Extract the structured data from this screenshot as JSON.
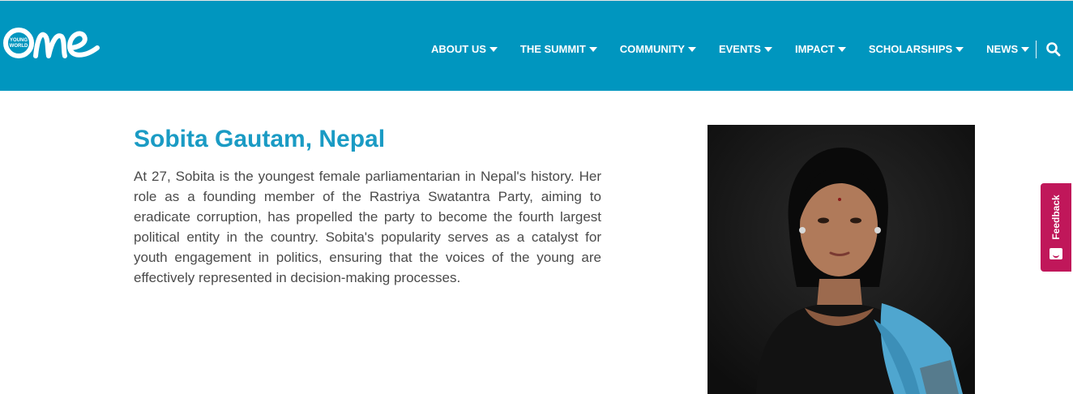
{
  "colors": {
    "header_bg": "#0096bf",
    "title": "#1a9bc4",
    "body_text": "#4a4a4a",
    "feedback_bg": "#c0175a"
  },
  "logo": {
    "small_text_line1": "YOUNG",
    "small_text_line2": "WORLD",
    "wordmark": "one",
    "icon": "one-young-world-logo"
  },
  "nav": {
    "items": [
      {
        "label": "ABOUT US",
        "icon": "caret-down-icon"
      },
      {
        "label": "THE SUMMIT",
        "icon": "caret-down-icon"
      },
      {
        "label": "COMMUNITY",
        "icon": "caret-down-icon"
      },
      {
        "label": "EVENTS",
        "icon": "caret-down-icon"
      },
      {
        "label": "IMPACT",
        "icon": "caret-down-icon"
      },
      {
        "label": "SCHOLARSHIPS",
        "icon": "caret-down-icon"
      },
      {
        "label": "NEWS",
        "icon": "caret-down-icon"
      }
    ],
    "search_icon": "search-icon"
  },
  "profile": {
    "title": "Sobita Gautam, Nepal",
    "bio": "At 27, Sobita is the youngest female parliamentarian in Nepal's history. Her role as a founding member of the Rastriya Swatantra Party, aiming to eradicate corruption, has propelled the party to become the fourth largest political entity in the country. Sobita's popularity serves as a catalyst for youth engagement in politics, ensuring that the voices of the young are effectively represented in decision-making processes."
  },
  "feedback": {
    "label": "Feedback",
    "icon": "smile-icon"
  }
}
